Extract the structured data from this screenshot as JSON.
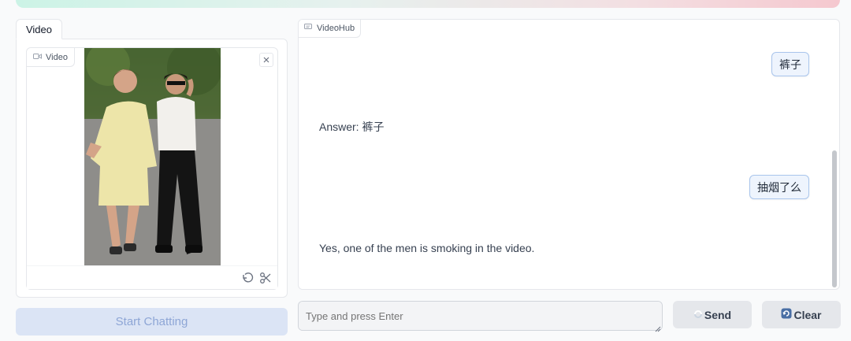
{
  "left": {
    "tab_label": "Video",
    "video_label": "Video",
    "start_button": "Start Chatting"
  },
  "chat": {
    "label": "VideoHub",
    "messages": [
      {
        "role": "user",
        "text": "裤子"
      },
      {
        "role": "bot",
        "text": "Answer: 裤子"
      },
      {
        "role": "user",
        "text": "抽烟了么"
      },
      {
        "role": "bot",
        "text": "Yes, one of the men is smoking in the video."
      }
    ]
  },
  "input": {
    "placeholder": "Type and press Enter"
  },
  "buttons": {
    "send": "Send",
    "clear": "Clear"
  },
  "colors": {
    "accent_user_bubble": "#eef4fd",
    "user_bubble_border": "#a9c5ec",
    "start_button_bg": "#dbe4f5",
    "start_button_text": "#8ea6d6"
  },
  "icons": [
    "video-camera-icon",
    "close-icon",
    "undo-icon",
    "scissors-icon",
    "chat-icon",
    "spinner-icon",
    "refresh-icon"
  ]
}
